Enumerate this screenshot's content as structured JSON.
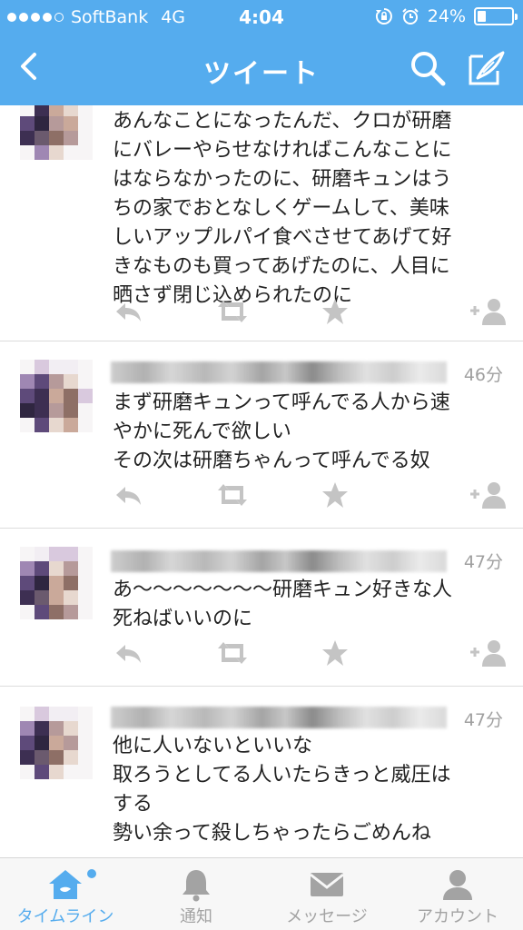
{
  "status_bar": {
    "carrier": "SoftBank",
    "network": "4G",
    "time": "4:04",
    "battery_text": "24%",
    "battery_level": 0.24,
    "signal_bars": 4,
    "signal_total": 5
  },
  "nav": {
    "title": "ツイート",
    "back_icon": "chevron-left-icon",
    "search_icon": "search-icon",
    "compose_icon": "compose-icon"
  },
  "tweets": [
    {
      "time": "",
      "text": "あんなことになったんだ、クロが研磨\nにバレーやらせなければこんなことに\nはならなかったのに、研磨キュンはう\nちの家でおとなしくゲームして、美味\nしいアップルパイ食べさせてあげて好\nきなものも買ってあげたのに、人目に\n晒さず閉じ込められたのに"
    },
    {
      "time": "46分",
      "text": "まず研磨キュンって呼んでる人から速\nやかに死んで欲しい\nその次は研磨ちゃんって呼んでる奴"
    },
    {
      "time": "47分",
      "text": "あ〜〜〜〜〜〜〜研磨キュン好きな人\n死ねばいいのに"
    },
    {
      "time": "47分",
      "text": "他に人いないといいな\n取ろうとしてる人いたらきっと威圧は\nする\n勢い余って殺しちゃったらごめんね"
    }
  ],
  "tabs": [
    {
      "label": "タイムライン",
      "icon": "home-icon",
      "active": true
    },
    {
      "label": "通知",
      "icon": "bell-icon",
      "active": false
    },
    {
      "label": "メッセージ",
      "icon": "envelope-icon",
      "active": false
    },
    {
      "label": "アカウント",
      "icon": "person-icon",
      "active": false
    }
  ],
  "colors": {
    "brand": "#55acee",
    "inactive": "#a3a3a3",
    "action_icon": "#c4c4c4"
  }
}
